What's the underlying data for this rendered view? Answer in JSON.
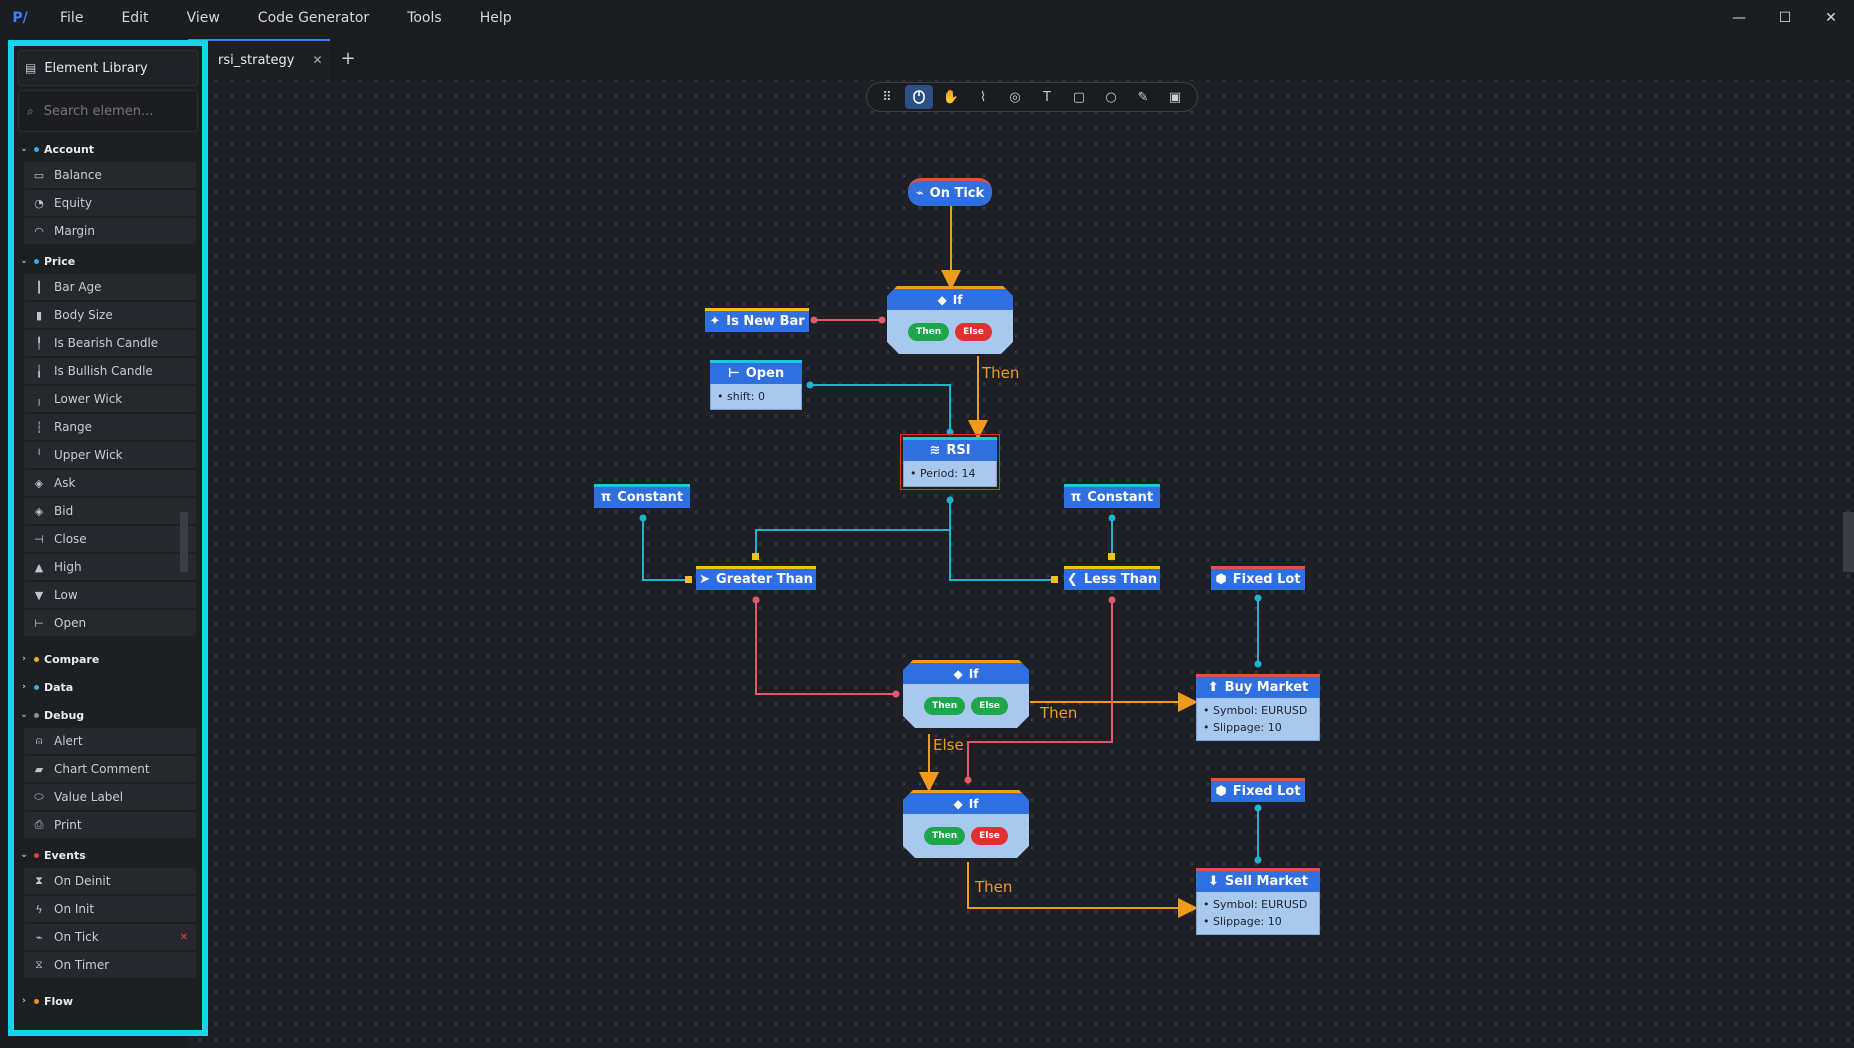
{
  "menubar": {
    "logo": "P/",
    "items": [
      "File",
      "Edit",
      "View",
      "Code Generator",
      "Tools",
      "Help"
    ]
  },
  "window_controls": {
    "minimize": "—",
    "maximize": "☐",
    "close": "✕"
  },
  "sidebar": {
    "title": "Element Library",
    "search_placeholder": "Search elemen...",
    "categories": {
      "account": {
        "label": "Account",
        "color": "#2ab3e0",
        "items": [
          "Balance",
          "Equity",
          "Margin"
        ]
      },
      "price": {
        "label": "Price",
        "color": "#2ab3e0",
        "items": [
          "Bar Age",
          "Body Size",
          "Is Bearish Candle",
          "Is Bullish Candle",
          "Lower Wick",
          "Range",
          "Upper Wick",
          "Ask",
          "Bid",
          "Close",
          "High",
          "Low",
          "Open"
        ]
      },
      "compare": {
        "label": "Compare",
        "color": "#f0b01c"
      },
      "data": {
        "label": "Data",
        "color": "#2ab3e0"
      },
      "debug": {
        "label": "Debug",
        "color": "#8a8e96",
        "items": [
          "Alert",
          "Chart Comment",
          "Value Label",
          "Print"
        ]
      },
      "events": {
        "label": "Events",
        "color": "#e04040",
        "items": [
          "On Deinit",
          "On Init",
          "On Tick",
          "On Timer"
        ],
        "remove_mark": "✕"
      },
      "flow": {
        "label": "Flow",
        "color": "#f0901c"
      }
    }
  },
  "tabs": [
    {
      "label": "rsi_strategy",
      "close": "✕"
    }
  ],
  "add_tab": "+",
  "nodes": {
    "on_tick": {
      "label": "On Tick"
    },
    "if1": {
      "label": "If",
      "then": "Then",
      "else": "Else"
    },
    "is_new_bar": {
      "label": "Is New Bar"
    },
    "open": {
      "label": "Open",
      "props": [
        "shift: 0"
      ]
    },
    "rsi": {
      "label": "RSI",
      "props": [
        "Period: 14"
      ]
    },
    "const1": {
      "label": "Constant"
    },
    "const2": {
      "label": "Constant"
    },
    "greater_than": {
      "label": "Greater Than"
    },
    "less_than": {
      "label": "Less Than"
    },
    "fixed_lot1": {
      "label": "Fixed Lot"
    },
    "fixed_lot2": {
      "label": "Fixed Lot"
    },
    "if2": {
      "label": "If",
      "then": "Then",
      "else": "Else"
    },
    "if3": {
      "label": "If",
      "then": "Then",
      "else": "Else"
    },
    "buy_market": {
      "label": "Buy Market",
      "props": [
        "Symbol: EURUSD",
        "Slippage: 10"
      ]
    },
    "sell_market": {
      "label": "Sell Market",
      "props": [
        "Symbol: EURUSD",
        "Slippage: 10"
      ]
    }
  },
  "edge_labels": {
    "then1": "Then",
    "then2": "Then",
    "else2": "Else",
    "then3": "Then"
  },
  "colors": {
    "accent": "#2f6fe0",
    "flow": "#f09b1c",
    "data_wire": "#1fb3d0",
    "bool_wire": "#e05a6a",
    "sidebar_highlight": "#10d8e8"
  }
}
